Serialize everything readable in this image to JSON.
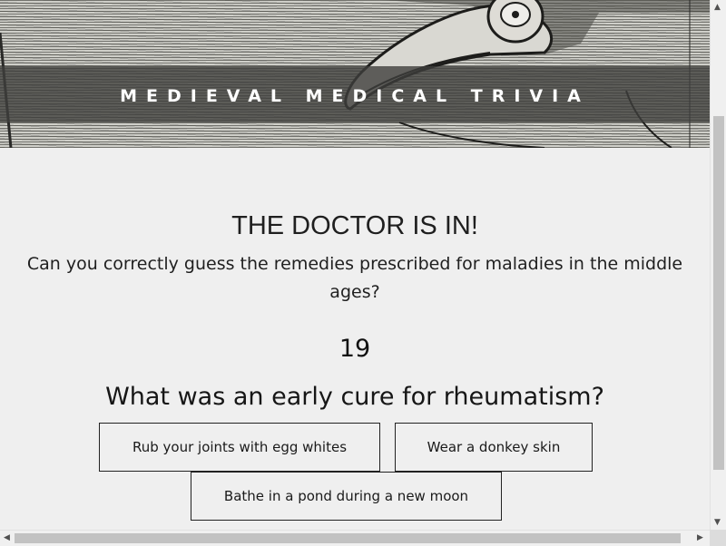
{
  "header": {
    "title": "MEDIEVAL MEDICAL TRIVIA",
    "image": "plague-doctor-engraving"
  },
  "main": {
    "heading": "THE DOCTOR IS IN!",
    "subtitle": "Can you correctly guess the remedies prescribed for maladies in the middle ages?",
    "counter": "19",
    "question": "What was an early cure for rheumatism?",
    "answers": [
      "Rub your joints with egg whites",
      "Wear a donkey skin",
      "Bathe in a pond during a new moon"
    ]
  },
  "scrollbars": {
    "up_icon": "scroll-up-arrow",
    "down_icon": "scroll-down-arrow",
    "left_icon": "scroll-left-arrow",
    "right_icon": "scroll-right-arrow"
  }
}
